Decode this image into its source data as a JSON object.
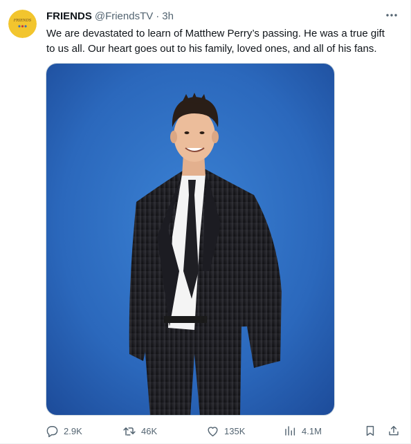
{
  "account": {
    "display_name": "FRIENDS",
    "handle": "@FriendsTV",
    "separator": "·",
    "time": "3h",
    "avatar_text": "FRIENDS",
    "avatar_bg": "#f2c52e"
  },
  "tweet": {
    "text": "We are devastated to learn of Matthew Perry’s passing. He was a true gift\nto us all. Our heart goes out to his family, loved ones, and all of his fans."
  },
  "icons": {
    "more": "more-horizontal-icon",
    "reply": "reply-icon",
    "retweet": "retweet-icon",
    "like": "heart-icon",
    "views": "views-chart-icon",
    "bookmark": "bookmark-icon",
    "share": "share-icon"
  },
  "actions": {
    "replies": "2.9K",
    "retweets": "46K",
    "likes": "135K",
    "views": "4.1M"
  },
  "colors": {
    "secondary_text": "#536471",
    "photo_background": "#2f6cc0"
  }
}
